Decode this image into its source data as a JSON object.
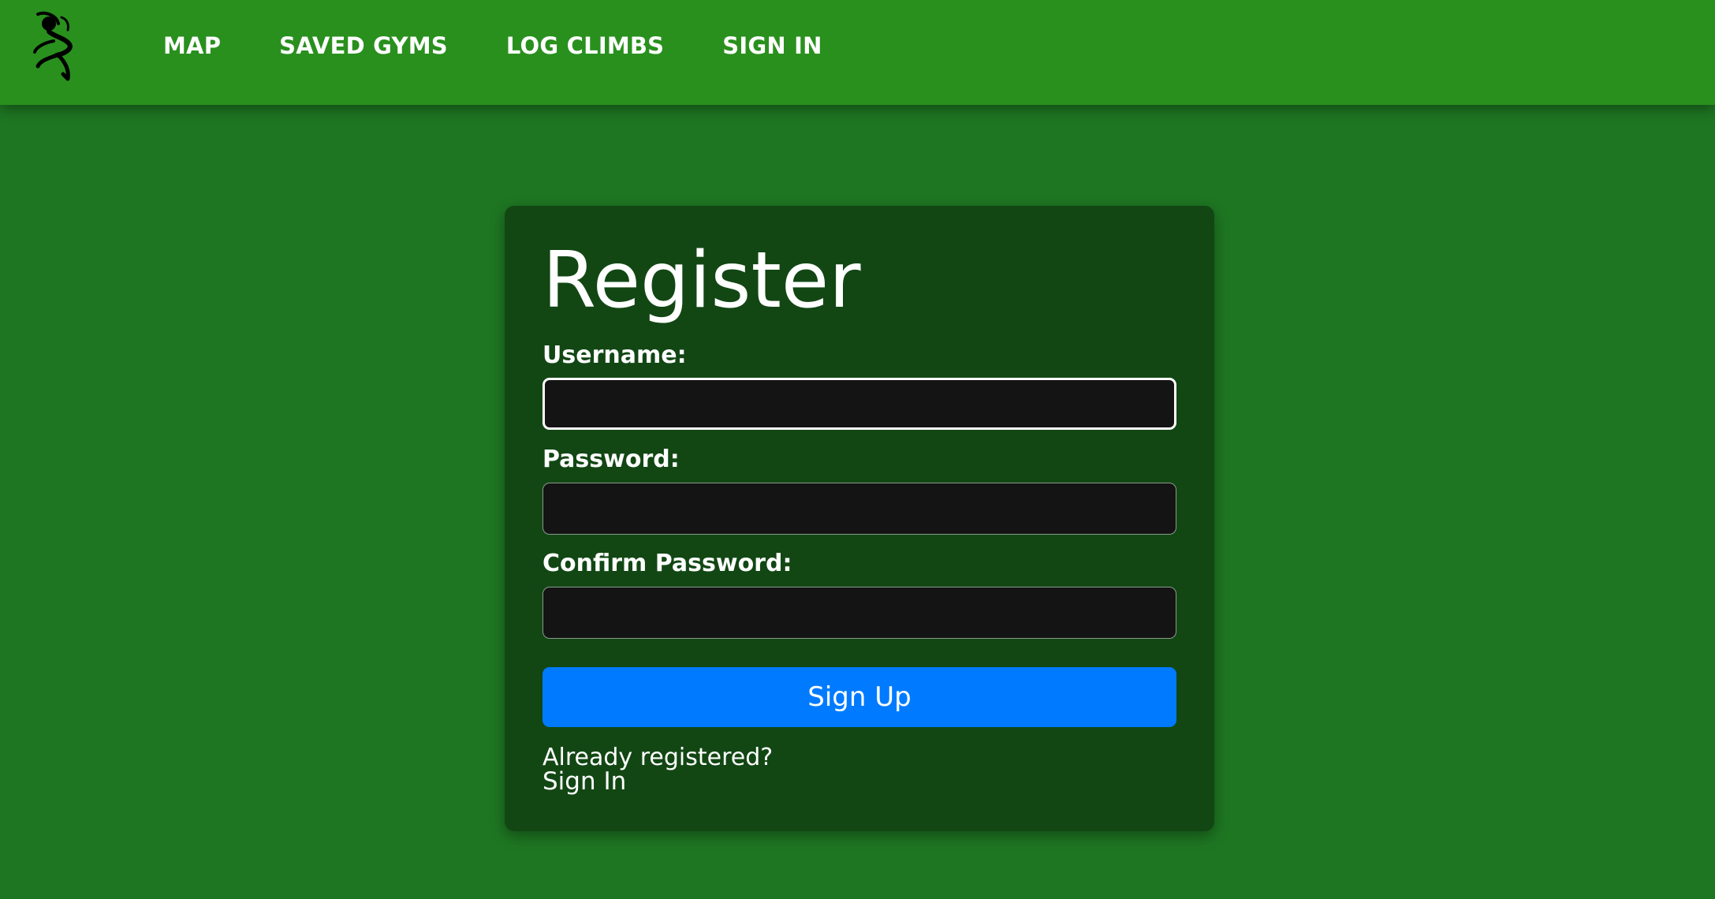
{
  "nav": {
    "logo_icon": "climber-logo-icon",
    "links": [
      {
        "label": "MAP"
      },
      {
        "label": "SAVED GYMS"
      },
      {
        "label": "LOG CLIMBS"
      },
      {
        "label": "SIGN IN"
      }
    ]
  },
  "form": {
    "title": "Register",
    "username": {
      "label": "Username:",
      "value": ""
    },
    "password": {
      "label": "Password:",
      "value": ""
    },
    "confirm_password": {
      "label": "Confirm Password:",
      "value": ""
    },
    "submit_label": "Sign Up",
    "already_registered_text": "Already registered?",
    "signin_link_label": "Sign In"
  },
  "colors": {
    "navbar": "#29901e",
    "background": "#1e7622",
    "card": "#124714",
    "input": "#141414",
    "button": "#007bff"
  }
}
